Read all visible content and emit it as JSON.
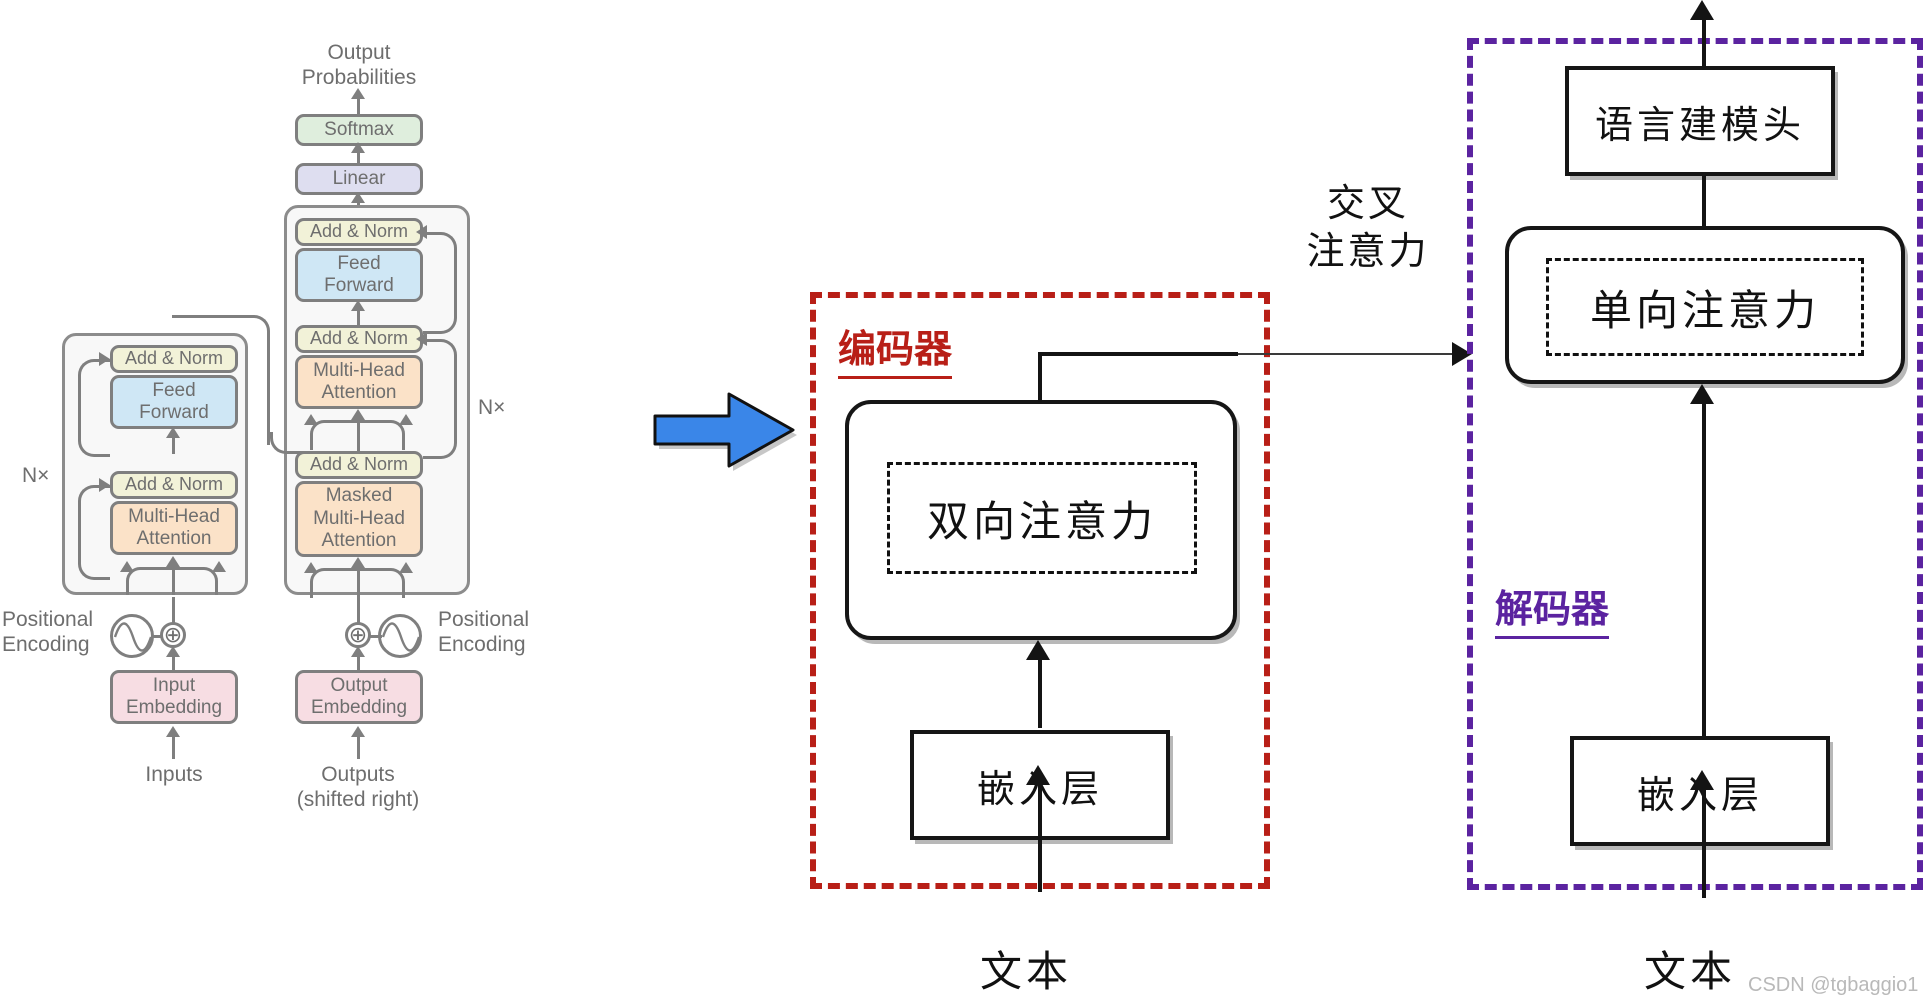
{
  "diagram": {
    "title": "Transformer encoder-decoder comparison diagram",
    "colors": {
      "encoder_accent": "#b81f17",
      "decoder_accent": "#5b23a0",
      "arrow_blue": "#3a86e8",
      "box_addnorm": "#f2f2d8",
      "box_feedforward": "#cfe7f5",
      "box_attention": "#fbe2c8",
      "box_embedding": "#f7dde3",
      "box_softmax": "#dfeedd",
      "box_linear": "#dedef0",
      "stroke_gray": "#7f7f7f",
      "stroke_black": "#141414"
    }
  },
  "transformer": {
    "output_probabilities": "Output\nProbabilities",
    "output_probabilities_line1": "Output",
    "output_probabilities_line2": "Probabilities",
    "softmax": "Softmax",
    "linear": "Linear",
    "encoder_stack": {
      "add_norm_top": "Add & Norm",
      "feed_forward": "Feed\nForward",
      "feed_forward_line1": "Feed",
      "feed_forward_line2": "Forward",
      "add_norm_bottom": "Add & Norm",
      "multi_head_attention_line1": "Multi-Head",
      "multi_head_attention_line2": "Attention",
      "nx": "N×"
    },
    "decoder_stack": {
      "add_norm_top": "Add & Norm",
      "feed_forward_line1": "Feed",
      "feed_forward_line2": "Forward",
      "add_norm_mid": "Add & Norm",
      "multi_head_attention_line1": "Multi-Head",
      "multi_head_attention_line2": "Attention",
      "add_norm_bottom": "Add & Norm",
      "masked_attention_line1": "Masked",
      "masked_attention_line2": "Multi-Head",
      "masked_attention_line3": "Attention",
      "nx": "N×"
    },
    "positional_encoding_left_line1": "Positional",
    "positional_encoding_left_line2": "Encoding",
    "positional_encoding_right_line1": "Positional",
    "positional_encoding_right_line2": "Encoding",
    "input_embedding_line1": "Input",
    "input_embedding_line2": "Embedding",
    "output_embedding_line1": "Output",
    "output_embedding_line2": "Embedding",
    "inputs": "Inputs",
    "outputs_line1": "Outputs",
    "outputs_line2": "(shifted right)",
    "plus_symbol": "⊕"
  },
  "encoder_region": {
    "title": "编码器",
    "attention_block": "双向注意力",
    "embedding_block": "嵌入层",
    "input_text": "文本"
  },
  "decoder_region": {
    "title": "解码器",
    "lm_head": "语言建模头",
    "attention_block": "单向注意力",
    "embedding_block": "嵌入层",
    "input_text": "文本"
  },
  "cross_attention": {
    "label_line1": "交叉",
    "label_line2": "注意力"
  },
  "watermark": {
    "text": "CSDN @tgbaggio1"
  }
}
